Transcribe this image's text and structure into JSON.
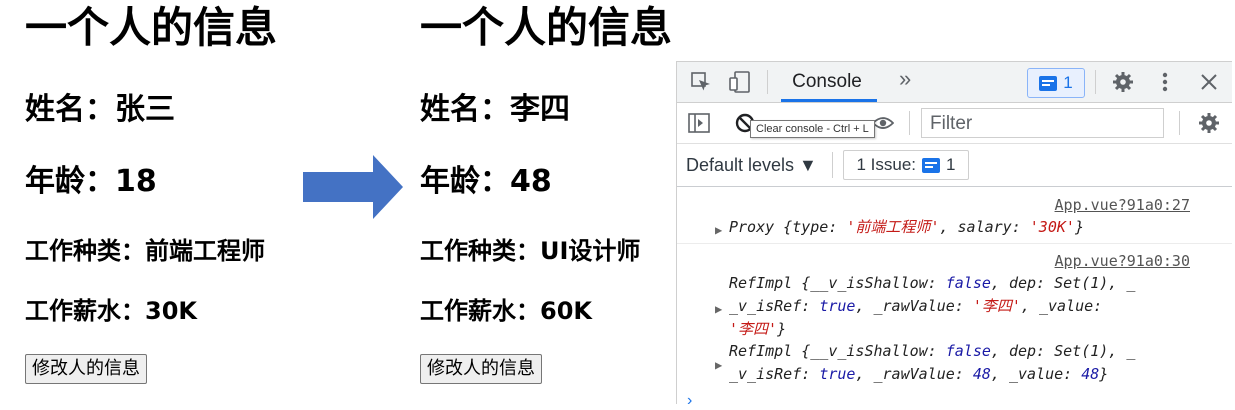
{
  "left_panel": {
    "title": "一个人的信息",
    "name": "姓名：张三",
    "age": "年龄：18",
    "job_type": "工作种类：前端工程师",
    "salary": "工作薪水：30K",
    "button": "修改人的信息"
  },
  "right_panel": {
    "title": "一个人的信息",
    "name": "姓名：李四",
    "age": "年龄：48",
    "job_type": "工作种类：UI设计师",
    "salary": "工作薪水：60K",
    "button": "修改人的信息"
  },
  "arrow_color": "#4472c4",
  "devtools": {
    "tab_console": "Console",
    "more_tabs": "»",
    "issue_badge_count": "1",
    "filter_placeholder": "Filter",
    "tooltip": "Clear console - Ctrl + L",
    "default_levels": "Default levels ▼",
    "issues_label": "1 Issue:",
    "issues_count": "1",
    "logs": [
      {
        "source": "App.vue?91a0:27",
        "lines": [
          {
            "segments": [
              [
                "k",
                "Proxy {type: "
              ],
              [
                "s",
                "'前端工程师'"
              ],
              [
                "k",
                ", salary: "
              ],
              [
                "s",
                "'30K'"
              ],
              [
                "k",
                "}"
              ]
            ]
          }
        ]
      },
      {
        "source": "App.vue?91a0:30",
        "lines": [
          {
            "segments": [
              [
                "k",
                "RefImpl {__v_isShallow: "
              ],
              [
                "b",
                "false"
              ],
              [
                "k",
                ", dep: Set(1), _"
              ]
            ]
          },
          {
            "segments": [
              [
                "k",
                "_v_isRef: "
              ],
              [
                "b",
                "true"
              ],
              [
                "k",
                ", _rawValue: "
              ],
              [
                "s",
                "'李四'"
              ],
              [
                "k",
                ", _value:"
              ]
            ]
          },
          {
            "segments": [
              [
                "s",
                "'李四'"
              ],
              [
                "k",
                "}"
              ]
            ]
          },
          {
            "segments": [
              [
                "k",
                "RefImpl {__v_isShallow: "
              ],
              [
                "b",
                "false"
              ],
              [
                "k",
                ", dep: Set(1), _"
              ]
            ]
          },
          {
            "segments": [
              [
                "k",
                "_v_isRef: "
              ],
              [
                "b",
                "true"
              ],
              [
                "k",
                ", _rawValue: "
              ],
              [
                "b",
                "48"
              ],
              [
                "k",
                ", _value: "
              ],
              [
                "b",
                "48"
              ],
              [
                "k",
                "}"
              ]
            ]
          }
        ]
      }
    ],
    "colors": {
      "string": "#c41a16",
      "keyword": "#1a1aa6",
      "accent": "#1a73e8"
    }
  }
}
